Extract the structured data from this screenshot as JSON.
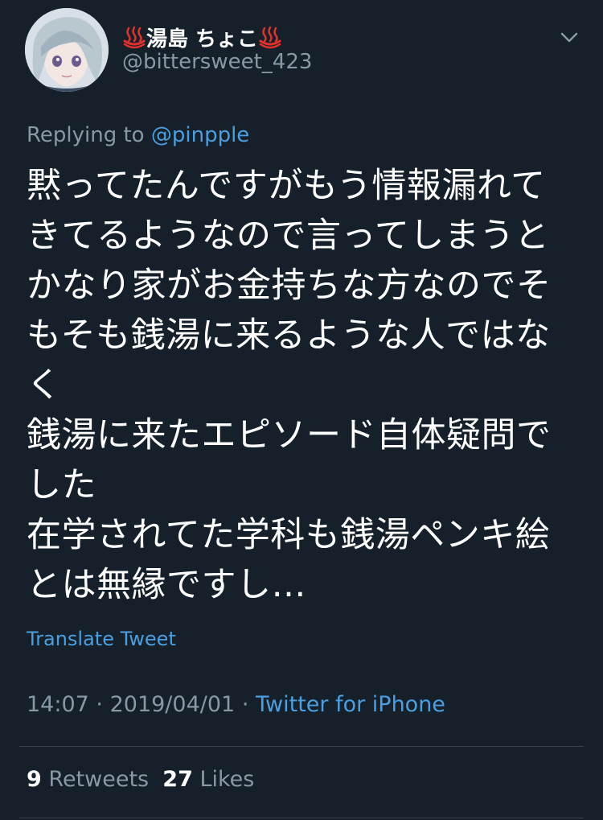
{
  "user": {
    "display_name": "湯島 ちょこ",
    "handle": "@bittersweet_423",
    "name_emoji": "hot-springs-icon"
  },
  "reply": {
    "prefix": "Replying to",
    "mention": "@pinpple"
  },
  "body_lines": [
    "黙ってたんですがもう情報漏れて",
    "きてるようなので言ってしまうと",
    "かなり家がお金持ちな方なのでそ",
    "もそも銭湯に来るような人ではな",
    "く",
    "銭湯に来たエピソード自体疑問で",
    "した",
    "在学されてた学科も銭湯ペンキ絵",
    "とは無縁ですし…"
  ],
  "translate_label": "Translate Tweet",
  "meta": {
    "time": "14:07",
    "date": "2019/04/01",
    "separator": "·",
    "source": "Twitter for iPhone"
  },
  "stats": {
    "retweets_count": "9",
    "retweets_label": "Retweets",
    "likes_count": "27",
    "likes_label": "Likes"
  },
  "colors": {
    "background": "#15202b",
    "accent": "#4a9fe0",
    "secondary_text": "#8899a6",
    "divider": "#38444d"
  }
}
